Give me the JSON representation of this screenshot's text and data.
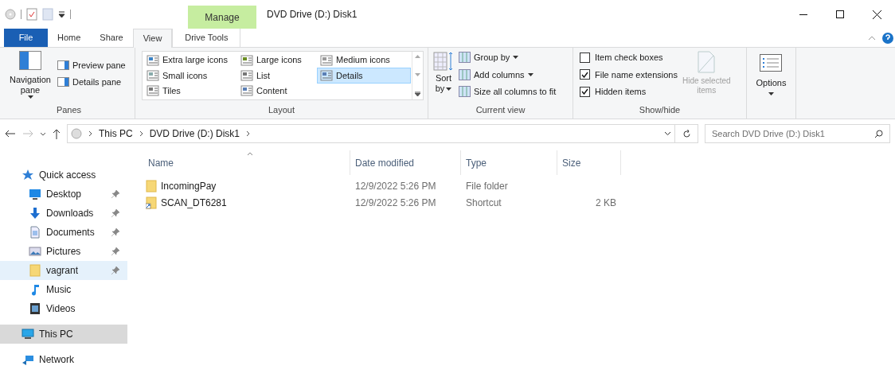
{
  "window": {
    "title": "DVD Drive (D:) Disk1",
    "contextual_tab": "Manage"
  },
  "ribbon_tabs": [
    {
      "label": "File",
      "kind": "file",
      "selected": false
    },
    {
      "label": "Home",
      "kind": "normal",
      "selected": false
    },
    {
      "label": "Share",
      "kind": "normal",
      "selected": false
    },
    {
      "label": "View",
      "kind": "normal",
      "selected": true
    },
    {
      "label": "Drive Tools",
      "kind": "contextual",
      "selected": false
    }
  ],
  "panes": {
    "label": "Panes",
    "navigation_pane": "Navigation pane",
    "items": [
      "Preview pane",
      "Details pane"
    ]
  },
  "layout": {
    "label": "Layout",
    "options": [
      {
        "label": "Extra large icons",
        "selected": false
      },
      {
        "label": "Large icons",
        "selected": false
      },
      {
        "label": "Medium icons",
        "selected": false
      },
      {
        "label": "Small icons",
        "selected": false
      },
      {
        "label": "List",
        "selected": false
      },
      {
        "label": "Details",
        "selected": true
      },
      {
        "label": "Tiles",
        "selected": false
      },
      {
        "label": "Content",
        "selected": false
      }
    ]
  },
  "current_view": {
    "label": "Current view",
    "sort_line1": "Sort",
    "sort_line2": "by",
    "items": [
      {
        "label": "Group by",
        "dropdown": true
      },
      {
        "label": "Add columns",
        "dropdown": true
      },
      {
        "label": "Size all columns to fit",
        "dropdown": false
      }
    ]
  },
  "show_hide": {
    "label": "Show/hide",
    "checkboxes": [
      {
        "label": "Item check boxes",
        "checked": false
      },
      {
        "label": "File name extensions",
        "checked": true
      },
      {
        "label": "Hidden items",
        "checked": true
      }
    ],
    "hide_selected": {
      "line1": "Hide selected",
      "line2": "items",
      "disabled": true
    }
  },
  "options": {
    "label": "Options"
  },
  "address": {
    "crumbs": [
      "This PC",
      "DVD Drive (D:) Disk1"
    ]
  },
  "search": {
    "placeholder": "Search DVD Drive (D:) Disk1"
  },
  "sidebar": [
    {
      "label": "Quick access",
      "kind": "star",
      "selected": false,
      "hovered": false,
      "children": [
        {
          "label": "Desktop",
          "kind": "desktop",
          "pinned": true,
          "selected": false,
          "hovered": false
        },
        {
          "label": "Downloads",
          "kind": "download",
          "pinned": true,
          "selected": false,
          "hovered": false
        },
        {
          "label": "Documents",
          "kind": "document",
          "pinned": true,
          "selected": false,
          "hovered": false
        },
        {
          "label": "Pictures",
          "kind": "pictures",
          "pinned": true,
          "selected": false,
          "hovered": false
        },
        {
          "label": "vagrant",
          "kind": "folder",
          "pinned": true,
          "selected": false,
          "hovered": true
        },
        {
          "label": "Music",
          "kind": "music",
          "pinned": false,
          "selected": false,
          "hovered": false
        },
        {
          "label": "Videos",
          "kind": "video",
          "pinned": false,
          "selected": false,
          "hovered": false
        }
      ]
    },
    {
      "label": "This PC",
      "kind": "pc",
      "selected": true,
      "hovered": false
    },
    {
      "label": "Network",
      "kind": "network",
      "selected": false,
      "hovered": false
    }
  ],
  "columns": [
    {
      "label": "Name",
      "sorted": true
    },
    {
      "label": "Date modified",
      "sorted": false
    },
    {
      "label": "Type",
      "sorted": false
    },
    {
      "label": "Size",
      "sorted": false
    }
  ],
  "rows": [
    {
      "kind": "folder",
      "name": "IncomingPay",
      "date": "12/9/2022 5:26 PM",
      "type": "File folder"
    },
    {
      "kind": "shortcut",
      "name": "SCAN_DT6281",
      "date": "12/9/2022 5:26 PM",
      "type": "Shortcut",
      "size": "2 KB"
    }
  ]
}
